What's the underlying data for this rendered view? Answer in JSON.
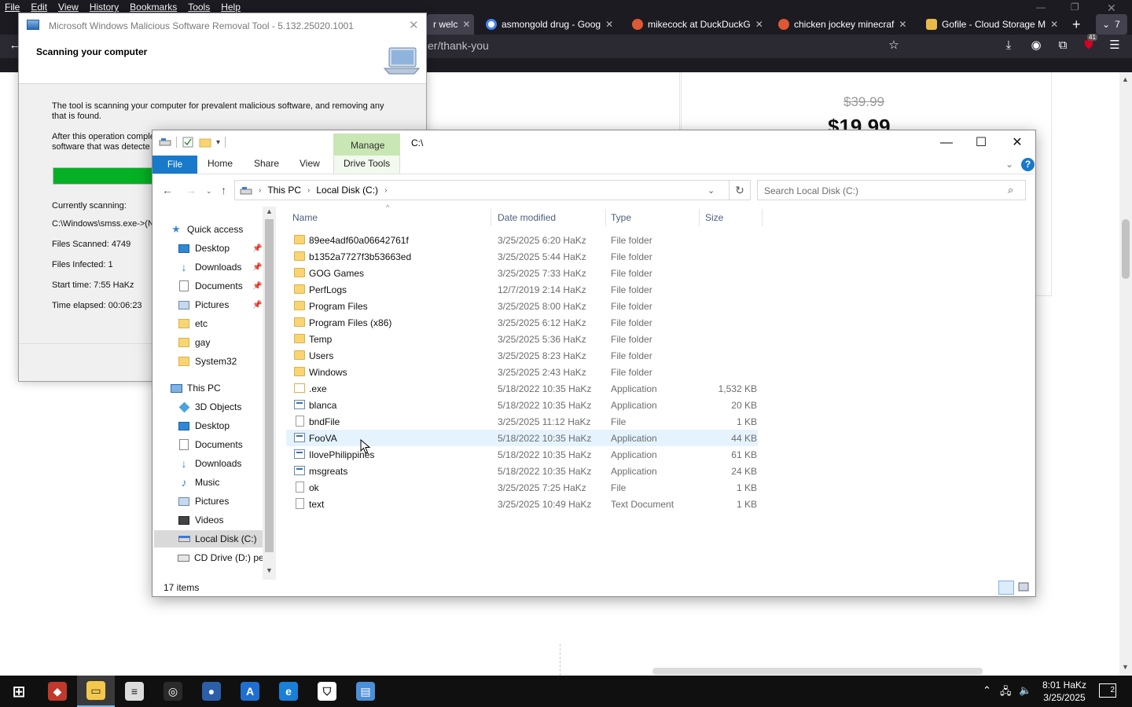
{
  "browser": {
    "menu": [
      "File",
      "Edit",
      "View",
      "History",
      "Bookmarks",
      "Tools",
      "Help"
    ],
    "tabs": [
      {
        "label": "r welc",
        "color": "#d70022",
        "active": true
      },
      {
        "label": "asmongold drug - Goog",
        "color": "#4285f4",
        "active": false
      },
      {
        "label": "mikecock at DuckDuckG",
        "color": "#de5833",
        "active": false
      },
      {
        "label": "chicken jockey minecraf",
        "color": "#de5833",
        "active": false
      },
      {
        "label": "Gofile - Cloud Storage M",
        "color": "#e9b949",
        "active": false
      }
    ],
    "tab_overflow_count": "7",
    "extension_badge": "41",
    "url": "er/thank-you",
    "page": {
      "old_price": "$39.99",
      "new_price": "$19.99"
    }
  },
  "msrt": {
    "title": "Microsoft Windows Malicious Software Removal Tool - 5.132.25020.1001",
    "heading": "Scanning your computer",
    "description": "The tool is scanning your computer for prevalent malicious software, and removing any that is found.",
    "after_text_1": "After this operation comple",
    "after_text_2": "software that was detecte",
    "progress": 0.5,
    "currently_scanning_label": "Currently scanning:",
    "currently_scanning_path": "C:\\Windows\\smss.exe->(N",
    "files_scanned": "Files Scanned: 4749",
    "files_infected": "Files Infected: 1",
    "start_time": "Start time: 7:55 HaKz",
    "time_elapsed": "Time elapsed: 00:06:23"
  },
  "explorer": {
    "title": "C:\\",
    "manage_tab": "Manage",
    "ribbon_tabs": {
      "file": "File",
      "home": "Home",
      "share": "Share",
      "view": "View",
      "drive_tools": "Drive Tools"
    },
    "breadcrumb": [
      "This PC",
      "Local Disk (C:)"
    ],
    "search_placeholder": "Search Local Disk (C:)",
    "columns": {
      "name": "Name",
      "date": "Date modified",
      "type": "Type",
      "size": "Size"
    },
    "nav_pane": [
      {
        "label": "Quick access",
        "icon": "star-icon",
        "level": 0,
        "pinned": false
      },
      {
        "label": "Desktop",
        "icon": "desktop-icon",
        "level": 1,
        "pinned": true
      },
      {
        "label": "Downloads",
        "icon": "download-icon",
        "level": 1,
        "pinned": true
      },
      {
        "label": "Documents",
        "icon": "documents-icon",
        "level": 1,
        "pinned": true
      },
      {
        "label": "Pictures",
        "icon": "pictures-icon",
        "level": 1,
        "pinned": true
      },
      {
        "label": "etc",
        "icon": "folder-icon",
        "level": 1,
        "pinned": false
      },
      {
        "label": "gay",
        "icon": "folder-icon",
        "level": 1,
        "pinned": false
      },
      {
        "label": "System32",
        "icon": "folder-icon",
        "level": 1,
        "pinned": false
      },
      {
        "label": "This PC",
        "icon": "computer-icon",
        "level": 0,
        "pinned": false
      },
      {
        "label": "3D Objects",
        "icon": "cube-icon",
        "level": 1,
        "pinned": false
      },
      {
        "label": "Desktop",
        "icon": "desktop-icon",
        "level": 1,
        "pinned": false
      },
      {
        "label": "Documents",
        "icon": "documents-icon",
        "level": 1,
        "pinned": false
      },
      {
        "label": "Downloads",
        "icon": "download-icon",
        "level": 1,
        "pinned": false
      },
      {
        "label": "Music",
        "icon": "music-icon",
        "level": 1,
        "pinned": false
      },
      {
        "label": "Pictures",
        "icon": "pictures-icon",
        "level": 1,
        "pinned": false
      },
      {
        "label": "Videos",
        "icon": "video-icon",
        "level": 1,
        "pinned": false
      },
      {
        "label": "Local Disk (C:)",
        "icon": "drive-icon",
        "level": 1,
        "pinned": false,
        "selected": true
      },
      {
        "label": "CD Drive (D:) per",
        "icon": "cd-drive-icon",
        "level": 1,
        "pinned": false
      }
    ],
    "files": [
      {
        "name": "89ee4adf60a06642761f",
        "date": "3/25/2025 6:20 HaKz",
        "type": "File folder",
        "size": "",
        "icon": "folder"
      },
      {
        "name": "b1352a7727f3b53663ed",
        "date": "3/25/2025 5:44 HaKz",
        "type": "File folder",
        "size": "",
        "icon": "folder"
      },
      {
        "name": "GOG Games",
        "date": "3/25/2025 7:33 HaKz",
        "type": "File folder",
        "size": "",
        "icon": "folder"
      },
      {
        "name": "PerfLogs",
        "date": "12/7/2019 2:14 HaKz",
        "type": "File folder",
        "size": "",
        "icon": "folder"
      },
      {
        "name": "Program Files",
        "date": "3/25/2025 8:00 HaKz",
        "type": "File folder",
        "size": "",
        "icon": "folder"
      },
      {
        "name": "Program Files (x86)",
        "date": "3/25/2025 6:12 HaKz",
        "type": "File folder",
        "size": "",
        "icon": "folder"
      },
      {
        "name": "Temp",
        "date": "3/25/2025 5:36 HaKz",
        "type": "File folder",
        "size": "",
        "icon": "folder"
      },
      {
        "name": "Users",
        "date": "3/25/2025 8:23 HaKz",
        "type": "File folder",
        "size": "",
        "icon": "folder"
      },
      {
        "name": "Windows",
        "date": "3/25/2025 2:43 HaKz",
        "type": "File folder",
        "size": "",
        "icon": "folder"
      },
      {
        "name": ".exe",
        "date": "5/18/2022 10:35 HaKz",
        "type": "Application",
        "size": "1,532 KB",
        "icon": "folderopen"
      },
      {
        "name": "blanca",
        "date": "5/18/2022 10:35 HaKz",
        "type": "Application",
        "size": "20 KB",
        "icon": "app"
      },
      {
        "name": "bndFile",
        "date": "3/25/2025 11:12 HaKz",
        "type": "File",
        "size": "1 KB",
        "icon": "file"
      },
      {
        "name": "FooVA",
        "date": "5/18/2022 10:35 HaKz",
        "type": "Application",
        "size": "44 KB",
        "icon": "app",
        "hover": true
      },
      {
        "name": "IlovePhilippines",
        "date": "5/18/2022 10:35 HaKz",
        "type": "Application",
        "size": "61 KB",
        "icon": "app"
      },
      {
        "name": "msgreats",
        "date": "5/18/2022 10:35 HaKz",
        "type": "Application",
        "size": "24 KB",
        "icon": "app"
      },
      {
        "name": "ok",
        "date": "3/25/2025 7:25 HaKz",
        "type": "File",
        "size": "1 KB",
        "icon": "file"
      },
      {
        "name": "text",
        "date": "3/25/2025 10:49 HaKz",
        "type": "Text Document",
        "size": "1 KB",
        "icon": "file"
      }
    ],
    "status": "17 items"
  },
  "taskbar": {
    "apps": [
      {
        "name": "start-button",
        "color": "#101010",
        "glyph": "⊞"
      },
      {
        "name": "app-red",
        "color": "#c0392b",
        "glyph": "◆"
      },
      {
        "name": "app-file-explorer",
        "color": "#f2c94c",
        "glyph": "▭",
        "active": true
      },
      {
        "name": "app-notepad",
        "color": "#dcdcdc",
        "glyph": "≡"
      },
      {
        "name": "app-steam",
        "color": "#2a2a2a",
        "glyph": "◎"
      },
      {
        "name": "app-msrt",
        "color": "#2b5fa8",
        "glyph": "●"
      },
      {
        "name": "app-store",
        "color": "#1f6fd1",
        "glyph": "A"
      },
      {
        "name": "app-edge",
        "color": "#1a7fd6",
        "glyph": "e"
      },
      {
        "name": "app-security",
        "color": "#ffffff",
        "glyph": "⛉"
      },
      {
        "name": "app-msrt-2",
        "color": "#4b8fd8",
        "glyph": "▤"
      }
    ],
    "time": "8:01 HaKz",
    "date": "3/25/2025",
    "notification_count": "2"
  }
}
